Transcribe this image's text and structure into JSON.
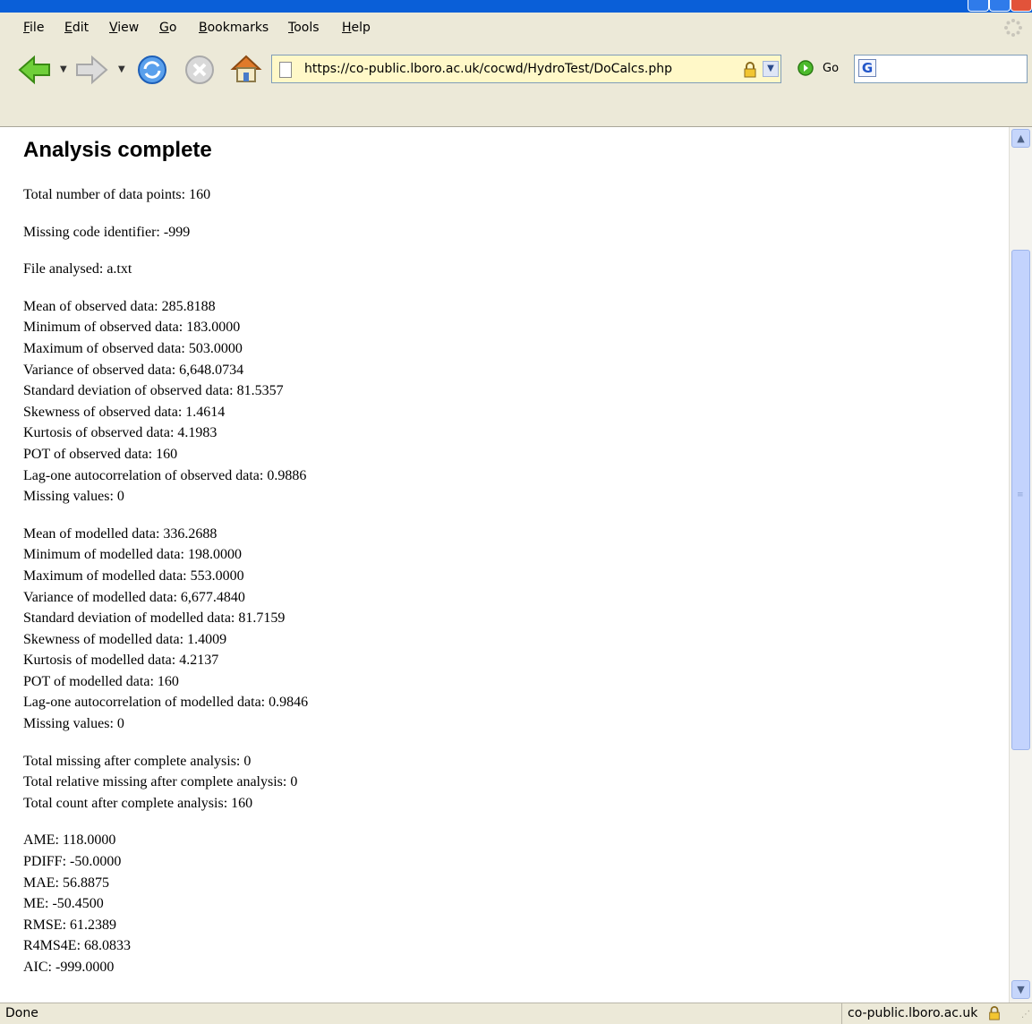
{
  "browser": {
    "menu": [
      {
        "label": "File",
        "key": "F",
        "rest": "ile"
      },
      {
        "label": "Edit",
        "key": "E",
        "rest": "dit"
      },
      {
        "label": "View",
        "key": "V",
        "rest": "iew"
      },
      {
        "label": "Go",
        "key": "G",
        "rest": "o"
      },
      {
        "label": "Bookmarks",
        "key": "B",
        "rest": "ookmarks"
      },
      {
        "label": "Tools",
        "key": "T",
        "rest": "ools"
      },
      {
        "label": "Help",
        "key": "H",
        "rest": "elp"
      }
    ],
    "address": "https://co-public.lboro.ac.uk/cocwd/HydroTest/DoCalcs.php",
    "go_label": "Go",
    "search_placeholder": "",
    "status_text": "Done",
    "status_domain": "co-public.lboro.ac.uk",
    "colors": {
      "chrome": "#ece9d8",
      "titlebar": "#0a5fd8",
      "url_secure_bg": "#fff8c8"
    }
  },
  "page": {
    "heading": "Analysis complete",
    "summary": [
      "Total number of data points: 160",
      "Missing code identifier: -999",
      "File analysed: a.txt"
    ],
    "observed": [
      "Mean of observed data: 285.8188",
      "Minimum of observed data: 183.0000",
      "Maximum of observed data: 503.0000",
      "Variance of observed data: 6,648.0734",
      "Standard deviation of observed data: 81.5357",
      "Skewness of observed data: 1.4614",
      "Kurtosis of observed data: 4.1983",
      "POT of observed data: 160",
      "Lag-one autocorrelation of observed data: 0.9886",
      "Missing values: 0"
    ],
    "modelled": [
      "Mean of modelled data: 336.2688",
      "Minimum of modelled data: 198.0000",
      "Maximum of modelled data: 553.0000",
      "Variance of modelled data: 6,677.4840",
      "Standard deviation of modelled data: 81.7159",
      "Skewness of modelled data: 1.4009",
      "Kurtosis of modelled data: 4.2137",
      "POT of modelled data: 160",
      "Lag-one autocorrelation of modelled data: 0.9846",
      "Missing values: 0"
    ],
    "totals": [
      "Total missing after complete analysis: 0",
      "Total relative missing after complete analysis: 0",
      "Total count after complete analysis: 160"
    ],
    "metrics": [
      "AME: 118.0000",
      "PDIFF: -50.0000",
      "MAE: 56.8875",
      "ME: -50.4500",
      "RMSE: 61.2389",
      "R4MS4E: 68.0833",
      "AIC: -999.0000"
    ]
  }
}
